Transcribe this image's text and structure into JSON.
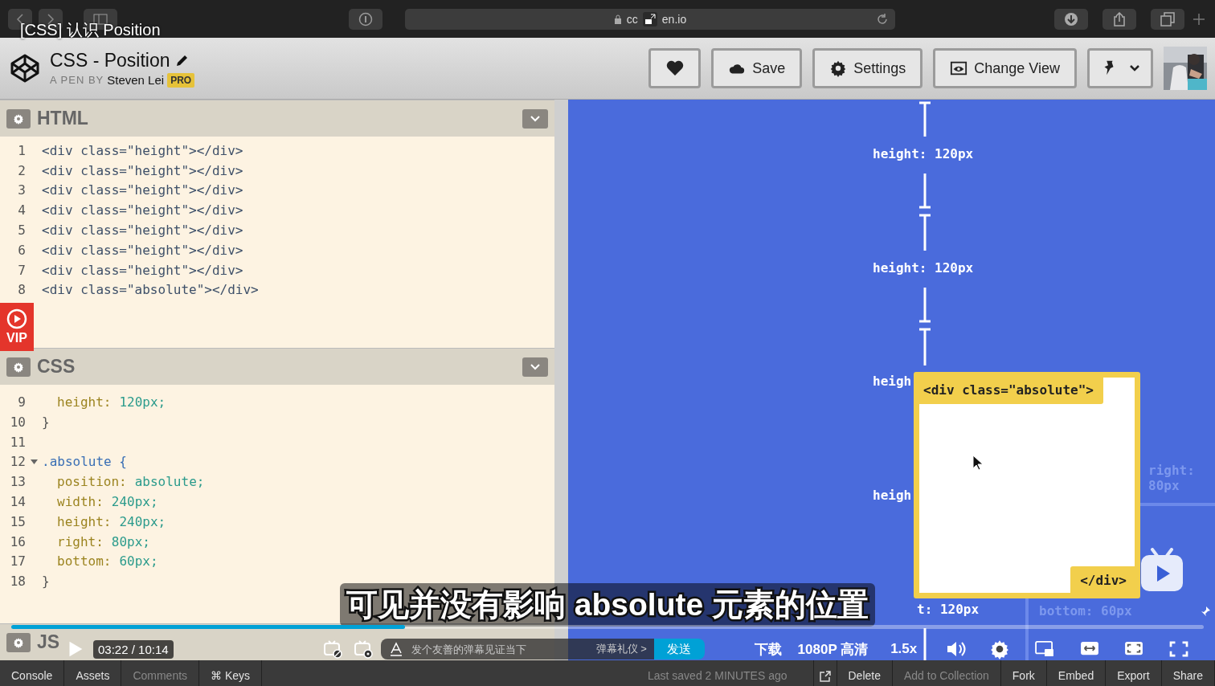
{
  "browser": {
    "url_start": "cc",
    "url_end": "en.io"
  },
  "pen": {
    "title": "CSS - Position",
    "byline": "A PEN BY",
    "author": "Steven Lei",
    "badge": "PRO",
    "buttons": [
      {
        "kind": "heart"
      },
      {
        "kind": "save",
        "label": "Save"
      },
      {
        "kind": "settings",
        "label": "Settings"
      },
      {
        "kind": "view",
        "label": "Change View"
      },
      {
        "kind": "pin"
      }
    ]
  },
  "editors": [
    {
      "title": "HTML",
      "lines": [
        {
          "number": "1",
          "kind": "markup",
          "text": "<div class=\"height\"></div>"
        },
        {
          "number": "2",
          "kind": "markup",
          "text": "<div class=\"height\"></div>"
        },
        {
          "number": "3",
          "kind": "markup",
          "text": "<div class=\"height\"></div>"
        },
        {
          "number": "4",
          "kind": "markup",
          "text": "<div class=\"height\"></div>"
        },
        {
          "number": "5",
          "kind": "markup",
          "text": "<div class=\"height\"></div>"
        },
        {
          "number": "6",
          "kind": "markup",
          "text": "<div class=\"height\"></div>"
        },
        {
          "number": "7",
          "kind": "markup",
          "text": "<div class=\"height\"></div>"
        },
        {
          "number": "8",
          "kind": "markup",
          "text": "<div class=\"absolute\"></div>"
        }
      ]
    },
    {
      "title": "CSS",
      "lines": [
        {
          "number": "9",
          "kind": "decl",
          "prop": "height:",
          "value": "120px;"
        },
        {
          "number": "10",
          "kind": "plain",
          "text": "}"
        },
        {
          "number": "11",
          "kind": "blank"
        },
        {
          "number": "12",
          "kind": "selector",
          "text": ".absolute {",
          "expanded": true
        },
        {
          "number": "13",
          "kind": "decl",
          "prop": "position:",
          "value": "absolute;"
        },
        {
          "number": "14",
          "kind": "decl",
          "prop": "width:",
          "value": "240px;"
        },
        {
          "number": "15",
          "kind": "decl",
          "prop": "height:",
          "value": "240px;"
        },
        {
          "number": "16",
          "kind": "decl",
          "prop": "right:",
          "value": "80px;"
        },
        {
          "number": "17",
          "kind": "decl",
          "prop": "bottom:",
          "value": "60px;"
        },
        {
          "number": "18",
          "kind": "plain",
          "text": "}"
        }
      ]
    },
    {
      "title": "JS"
    }
  ],
  "preview": {
    "labels": [
      "height: 120px",
      "height: 120px",
      "heigh",
      "heigh",
      "t: 120px"
    ],
    "offsets": [
      "right: 80px",
      "bottom: 60px"
    ],
    "box": {
      "open_tag": "<div class=\"absolute\">",
      "close_tag": "</div>"
    }
  },
  "footer": {
    "left": [
      {
        "label": "Console",
        "disabled": false
      },
      {
        "label": "Assets",
        "disabled": false
      },
      {
        "label": "Comments",
        "disabled": true
      },
      {
        "label": "⌘ Keys",
        "disabled": false
      }
    ],
    "saved": "Last saved 2 MINUTES ago",
    "right": [
      {
        "label": "Delete",
        "disabled": false
      },
      {
        "label": "Add to Collection",
        "disabled": true
      },
      {
        "label": "Fork",
        "disabled": false
      },
      {
        "label": "Embed",
        "disabled": false
      },
      {
        "label": "Export",
        "disabled": false
      },
      {
        "label": "Share",
        "disabled": false
      }
    ]
  },
  "video": {
    "title": "[CSS] 认识 Position",
    "badge": "VIP",
    "subtitle": "可见并没有影响 absolute 元素的位置",
    "progress": {
      "level": 0.33
    },
    "time": "03:22 / 10:14",
    "danmaku": {
      "placeholder": "发个友善的弹幕见证当下",
      "etiquette": "弹幕礼仪 >",
      "send": "发送"
    },
    "download": "下载",
    "quality": "1080P 高清",
    "speed": "1.5x"
  }
}
